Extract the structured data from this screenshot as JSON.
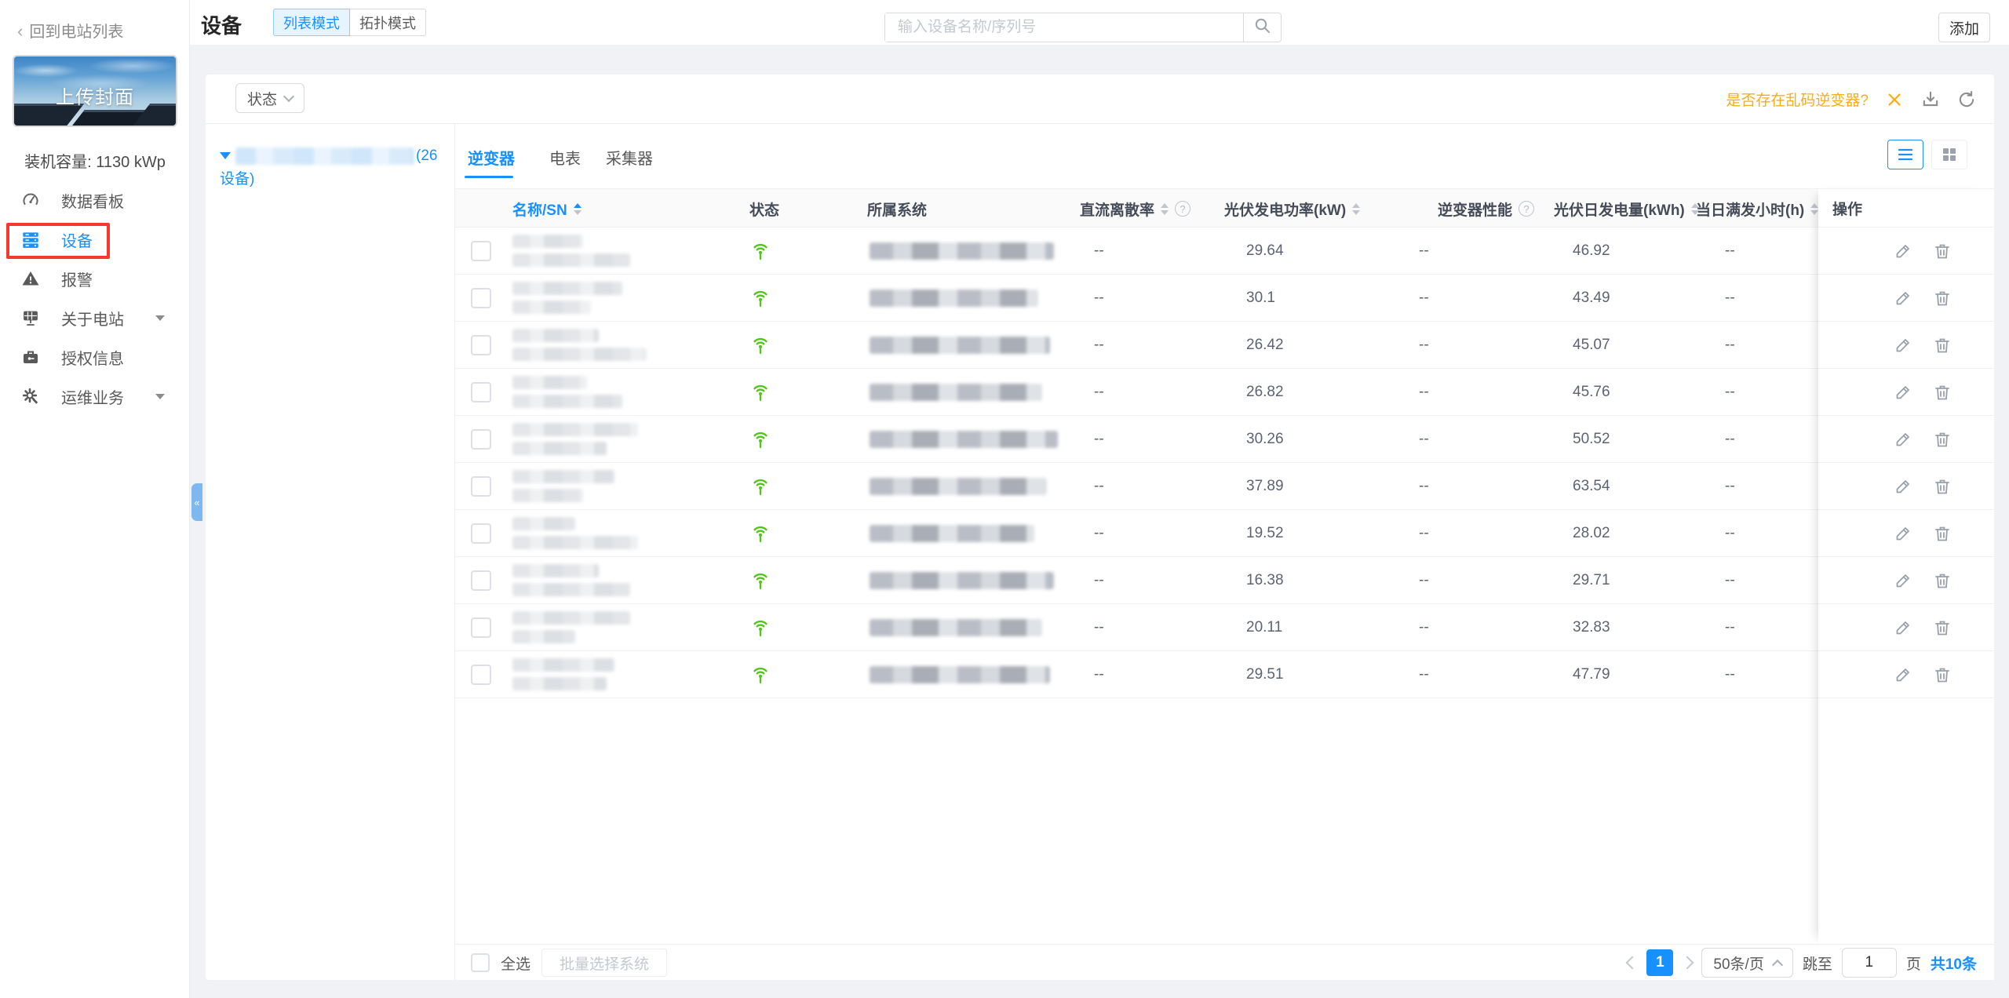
{
  "sidebar": {
    "back": "回到电站列表",
    "cover_label": "上传封面",
    "capacity": "装机容量: 1130 kWp",
    "items": [
      {
        "label": "数据看板",
        "icon": "dashboard-icon",
        "active": false,
        "caret": false
      },
      {
        "label": "设备",
        "icon": "devices-icon",
        "active": true,
        "caret": false,
        "annotated": true
      },
      {
        "label": "报警",
        "icon": "alarm-icon",
        "active": false,
        "caret": false
      },
      {
        "label": "关于电站",
        "icon": "plant-icon",
        "active": false,
        "caret": true
      },
      {
        "label": "授权信息",
        "icon": "license-icon",
        "active": false,
        "caret": false
      },
      {
        "label": "运维业务",
        "icon": "maintenance-icon",
        "active": false,
        "caret": true
      }
    ]
  },
  "header": {
    "title": "设备",
    "mode_list": "列表模式",
    "mode_topology": "拓扑模式",
    "search_placeholder": "输入设备名称/序列号",
    "add_label": "添加"
  },
  "toolbar": {
    "status_filter": "状态",
    "garbled_question": "是否存在乱码逆变器?"
  },
  "tree": {
    "device_count": "(26设备)"
  },
  "tabs": [
    {
      "label": "逆变器",
      "active": true
    },
    {
      "label": "电表",
      "active": false
    },
    {
      "label": "采集器",
      "active": false
    }
  ],
  "table": {
    "columns": [
      "名称/SN",
      "状态",
      "所属系统",
      "直流离散率",
      "光伏发电功率(kW)",
      "逆变器性能",
      "光伏日发电量(kWh)",
      "当日满发小时(h)",
      "操作"
    ],
    "rows": [
      {
        "status": "online",
        "dc_rate": "--",
        "power": "29.64",
        "performance": "--",
        "energy": "46.92",
        "full_hours": "--"
      },
      {
        "status": "online",
        "dc_rate": "--",
        "power": "30.1",
        "performance": "--",
        "energy": "43.49",
        "full_hours": "--"
      },
      {
        "status": "online",
        "dc_rate": "--",
        "power": "26.42",
        "performance": "--",
        "energy": "45.07",
        "full_hours": "--"
      },
      {
        "status": "online",
        "dc_rate": "--",
        "power": "26.82",
        "performance": "--",
        "energy": "45.76",
        "full_hours": "--"
      },
      {
        "status": "online",
        "dc_rate": "--",
        "power": "30.26",
        "performance": "--",
        "energy": "50.52",
        "full_hours": "--"
      },
      {
        "status": "online",
        "dc_rate": "--",
        "power": "37.89",
        "performance": "--",
        "energy": "63.54",
        "full_hours": "--"
      },
      {
        "status": "online",
        "dc_rate": "--",
        "power": "19.52",
        "performance": "--",
        "energy": "28.02",
        "full_hours": "--"
      },
      {
        "status": "online",
        "dc_rate": "--",
        "power": "16.38",
        "performance": "--",
        "energy": "29.71",
        "full_hours": "--"
      },
      {
        "status": "online",
        "dc_rate": "--",
        "power": "20.11",
        "performance": "--",
        "energy": "32.83",
        "full_hours": "--"
      },
      {
        "status": "online",
        "dc_rate": "--",
        "power": "29.51",
        "performance": "--",
        "energy": "47.79",
        "full_hours": "--"
      }
    ]
  },
  "footer": {
    "select_all": "全选",
    "batch_select": "批量选择系统",
    "page": "1",
    "page_size": "50条/页",
    "jump_prefix": "跳至",
    "jump_value": "1",
    "jump_suffix": "页",
    "total": "共10条"
  },
  "icons": {
    "search": "magnifier",
    "close": "x-mark",
    "download": "arrow-into-tray",
    "refresh": "circular-arrow",
    "online_status": "green-signal-antenna",
    "edit": "pencil",
    "delete": "trash-can",
    "sort": "caret-up-down",
    "help": "question-circle"
  },
  "colors": {
    "primary": "#1890ff",
    "warning": "#faad14",
    "success": "#52c41a",
    "annotation_box": "#f5392f",
    "table_header_bg": "#fafafa",
    "page_bg": "#f0f2f5"
  }
}
